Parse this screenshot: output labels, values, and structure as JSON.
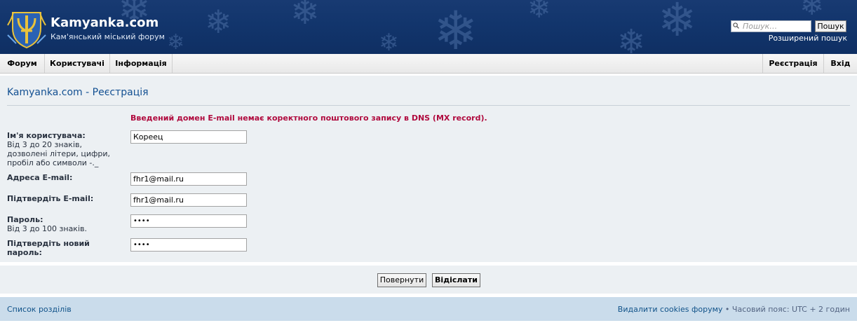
{
  "header": {
    "site_title": "Kamyanka.com",
    "site_description": "Кам'янський міський форум",
    "search_placeholder": "Пошук…",
    "search_button": "Пошук",
    "advanced_search": "Розширений пошук"
  },
  "nav": {
    "left": [
      "Форум",
      "Користувачі",
      "Інформація"
    ],
    "right": [
      "Реєстрація",
      "Вхід"
    ]
  },
  "main": {
    "title": "Kamyanka.com - Реєстрація",
    "error": "Введений домен E-mail немає коректного поштового запису в DNS (MX record).",
    "fields": [
      {
        "label": "Ім'я користувача:",
        "hint": "Від 3 до 20 знаків, дозволені літери, цифри, пробіл або символи -._",
        "value": "Кореец"
      },
      {
        "label": "Адреса E-mail:",
        "hint": "",
        "value": "fhr1@mail.ru"
      },
      {
        "label": "Підтвердіть E-mail:",
        "hint": "",
        "value": "fhr1@mail.ru"
      },
      {
        "label": "Пароль:",
        "hint": "Від 3 до 100 знаків.",
        "value": "••••"
      },
      {
        "label": "Підтвердіть новий пароль:",
        "hint": "",
        "value": "••••"
      }
    ]
  },
  "buttons": {
    "reset": "Повернути",
    "submit": "Відіслати"
  },
  "footer": {
    "index_link": "Список розділів",
    "delete_cookies": "Видалити cookies форуму",
    "separator": " • ",
    "timezone": "Часовий пояс: UTC + 2 годин"
  },
  "colors": {
    "header_bg": "#12356c",
    "error": "#b00a3e",
    "link": "#105289",
    "panel_bg": "#ecf0f3",
    "footer_bg": "#cadceb"
  },
  "icons": [
    "site-logo",
    "search-icon",
    "snowflake-decoration"
  ]
}
